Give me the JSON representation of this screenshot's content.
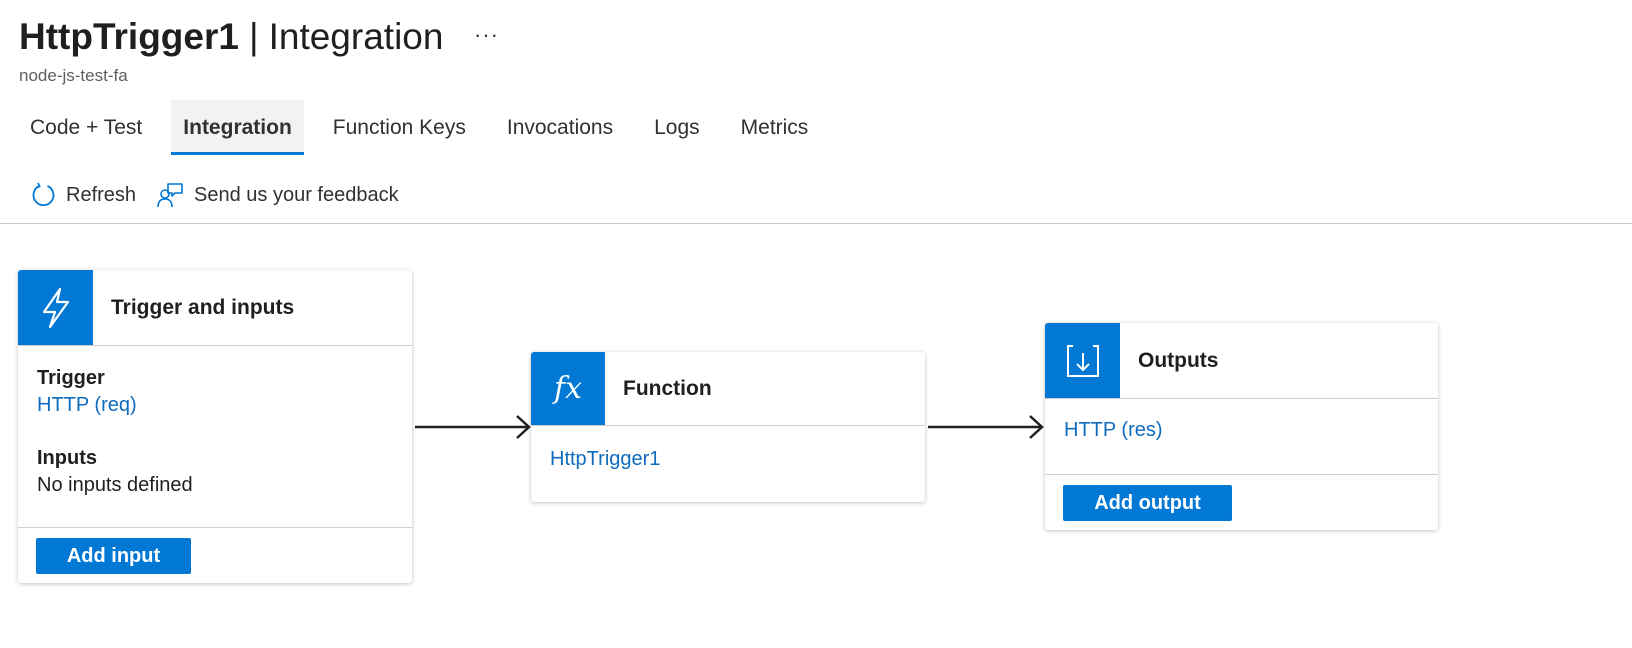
{
  "header": {
    "title_name": "HttpTrigger1",
    "title_separator": "|",
    "title_section": "Integration",
    "more_label": "···",
    "subtitle": "node-js-test-fa"
  },
  "tabs": [
    {
      "label": "Code + Test",
      "active": false
    },
    {
      "label": "Integration",
      "active": true
    },
    {
      "label": "Function Keys",
      "active": false
    },
    {
      "label": "Invocations",
      "active": false
    },
    {
      "label": "Logs",
      "active": false
    },
    {
      "label": "Metrics",
      "active": false
    }
  ],
  "commands": {
    "refresh_label": "Refresh",
    "refresh_icon": "refresh-icon",
    "feedback_label": "Send us your feedback",
    "feedback_icon": "feedback-icon"
  },
  "trigger_card": {
    "title": "Trigger and inputs",
    "icon": "lightning-icon",
    "trigger_label": "Trigger",
    "trigger_value": "HTTP (req)",
    "inputs_label": "Inputs",
    "inputs_value": "No inputs defined",
    "button_label": "Add input"
  },
  "function_card": {
    "title": "Function",
    "icon": "fx-icon",
    "icon_text": "fx",
    "function_link": "HttpTrigger1"
  },
  "outputs_card": {
    "title": "Outputs",
    "icon": "output-arrow-icon",
    "output_link": "HTTP (res)",
    "button_label": "Add output"
  },
  "colors": {
    "accent": "#0078d4",
    "link": "#0f6cbd",
    "text": "#201f1e",
    "divider": "#c8c6c4"
  }
}
